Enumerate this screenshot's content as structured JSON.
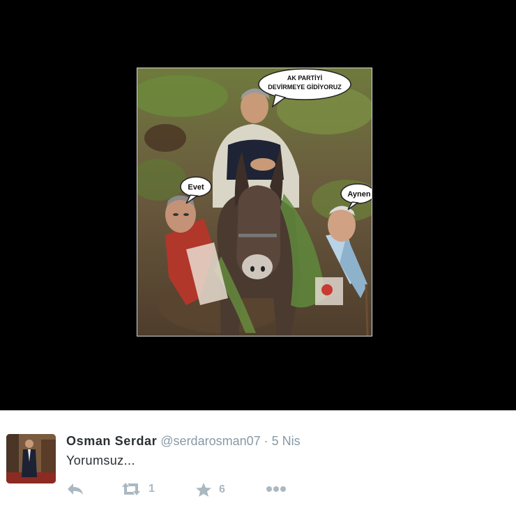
{
  "media": {
    "bubbles": {
      "top_line1": "AK PARTİYİ",
      "top_line2": "DEVİRMEYE GİDİYORUZ",
      "left": "Evet",
      "right": "Aynen"
    }
  },
  "tweet": {
    "fullname": "Osman Serdar",
    "username": "@serdarosman07",
    "separator": "·",
    "time": "5 Nis",
    "text": "Yorumsuz...",
    "actions": {
      "reply_icon": "reply-icon",
      "retweet_icon": "retweet-icon",
      "retweet_count": "1",
      "favorite_icon": "star-icon",
      "favorite_count": "6",
      "more_icon": "more-dots-icon"
    }
  },
  "colors": {
    "media_background": "#000000",
    "action_gray": "#aab8c2",
    "username_gray": "#8899a6",
    "name_dark": "#292f33"
  }
}
